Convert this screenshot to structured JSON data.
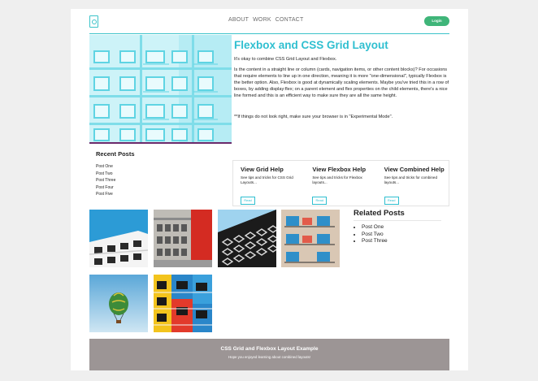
{
  "header": {
    "logo_icon": "logo-icon",
    "nav": [
      "ABOUT",
      "WORK",
      "CONTACT"
    ],
    "login_label": "Login"
  },
  "colors": {
    "accent": "#2fbfd0",
    "login": "#3fb579",
    "divider": "#6b2a6b",
    "footer": "#9c9595"
  },
  "main": {
    "title": "Flexbox and CSS Grid Layout",
    "intro": "It's okay to combine CSS Grid Layout and Flexbox.",
    "body": "Is the content in a straight line or column (cards, navigation items, or other content blocks)? For occasions that require elements to line up in one direction, meaning it is more \"one-dimensional\", typically Flexbox is the better option. Also, Flexbox is good at dynamically scaling elements. Maybe you've tried this in a row of boxes, by adding display:flex; on a parent element and flex properties on the child elements, there's a nice line formed and this is an efficient way to make sure they are all the same height.",
    "note": "**If things do not look right, make sure your browser is in \"Experimental Mode\"."
  },
  "recent_posts": {
    "title": "Recent Posts",
    "items": [
      "Post One",
      "Post Two",
      "Post Three",
      "Post Four",
      "Post Five"
    ]
  },
  "cards": [
    {
      "title": "View Grid Help",
      "text": "See tips and tricks for CSS Grid Layouts...",
      "button": "Read"
    },
    {
      "title": "View Flexbox Help",
      "text": "See tips and tricks for Flexbox layouts...",
      "button": "Read"
    },
    {
      "title": "View Combined Help",
      "text": "See tips and tricks for combined layouts...",
      "button": "Read"
    }
  ],
  "related_posts": {
    "title": "Related Posts",
    "items": [
      "Post One",
      "Post Two",
      "Post Three"
    ]
  },
  "footer": {
    "title": "CSS Grid and Flexbox Layout Example",
    "subtitle": "Hope you enjoyed learning about combined layouts!"
  }
}
